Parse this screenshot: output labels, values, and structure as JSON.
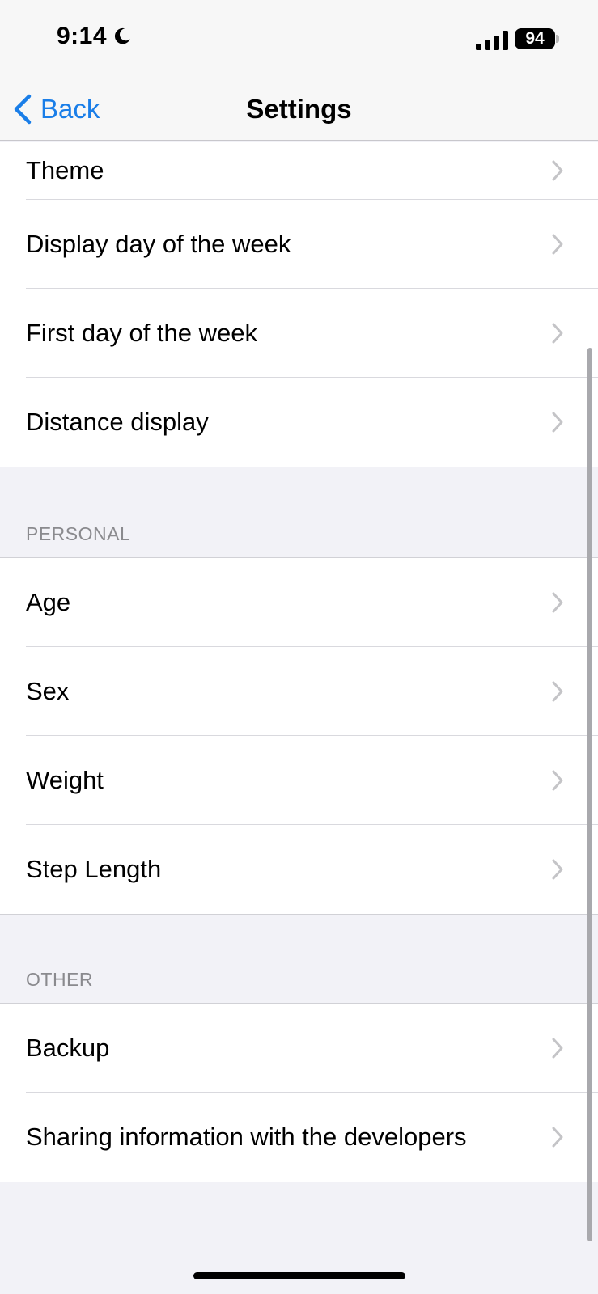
{
  "status_bar": {
    "time": "9:14",
    "battery_level": "94"
  },
  "nav": {
    "back_label": "Back",
    "title": "Settings"
  },
  "groups": {
    "top": {
      "items": [
        {
          "label": "Theme"
        },
        {
          "label": "Display day of the week"
        },
        {
          "label": "First day of the week"
        },
        {
          "label": "Distance display"
        }
      ]
    },
    "personal": {
      "header": "PERSONAL",
      "items": [
        {
          "label": "Age"
        },
        {
          "label": "Sex"
        },
        {
          "label": "Weight"
        },
        {
          "label": "Step Length"
        }
      ]
    },
    "other": {
      "header": "OTHER",
      "items": [
        {
          "label": "Backup"
        },
        {
          "label": "Sharing information with the developers"
        }
      ]
    }
  },
  "icons": {
    "back": "chevron-left-icon",
    "row_disclosure": "chevron-right-icon",
    "do_not_disturb": "moon-icon",
    "signal": "cellular-signal-icon",
    "battery": "battery-icon"
  },
  "colors": {
    "accent": "#1a7ee8",
    "background": "#f2f2f7",
    "separator": "#d9d9de",
    "section_header": "#8a8a8e",
    "chevron": "#c4c4c7"
  }
}
